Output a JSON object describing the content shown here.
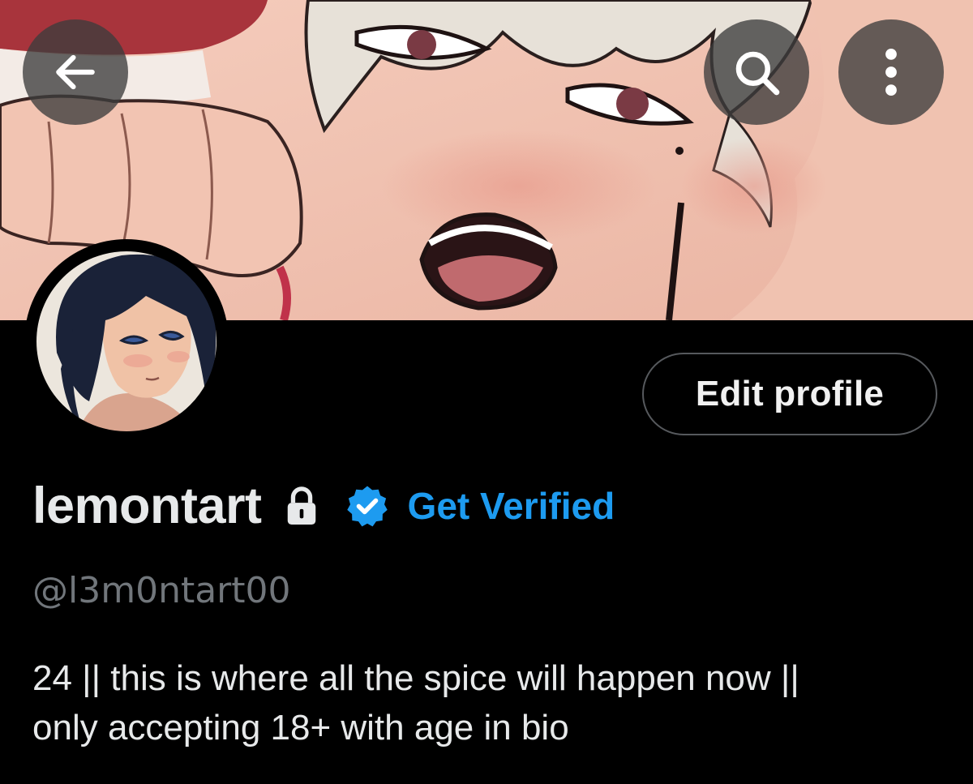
{
  "header": {
    "back_icon": "arrow-left-icon",
    "search_icon": "search-icon",
    "more_icon": "more-vertical-icon"
  },
  "profile": {
    "edit_button_label": "Edit profile",
    "display_name": "lemontart",
    "lock_icon": "lock-icon",
    "verified_icon": "verified-badge-icon",
    "get_verified_label": "Get Verified",
    "handle": "@l3m0ntart00",
    "bio_lines": [
      "24 || this is where all the spice will happen now ||",
      "only accepting 18+ with age in bio"
    ]
  },
  "colors": {
    "background": "#000000",
    "primary_text": "#e7e9ea",
    "secondary_text": "#71767b",
    "accent": "#1d9bf0",
    "button_border": "#56595d",
    "nav_button_bg": "#3c3c3c"
  }
}
